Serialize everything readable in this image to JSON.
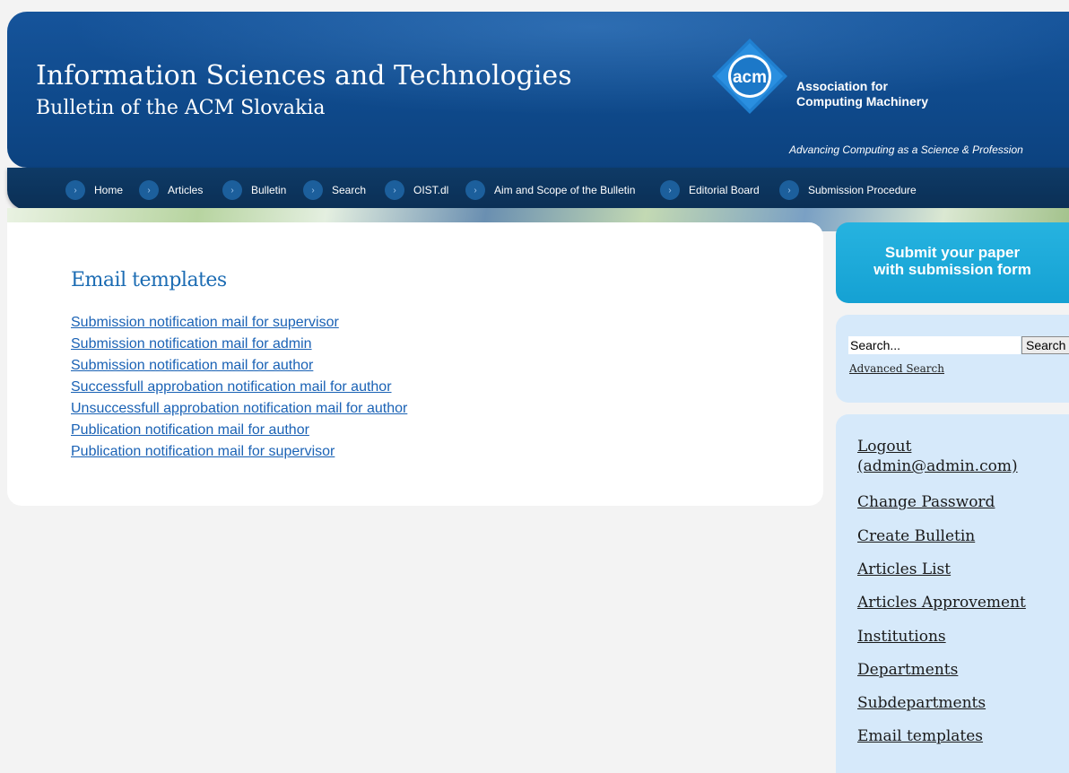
{
  "header": {
    "title": "Information Sciences and Technologies",
    "subtitle": "Bulletin of the ACM Slovakia",
    "acm_logo_text": "acm",
    "acm_org_line1": "Association for",
    "acm_org_line2": "Computing Machinery",
    "acm_tagline": "Advancing Computing as a Science & Profession"
  },
  "nav": {
    "items": [
      {
        "label": "Home"
      },
      {
        "label": "Articles"
      },
      {
        "label": "Bulletin"
      },
      {
        "label": "Search"
      },
      {
        "label": "OIST.dl"
      },
      {
        "label": "Aim and Scope of the Bulletin"
      },
      {
        "label": "Editorial Board"
      },
      {
        "label": "Submission Procedure"
      }
    ],
    "bullet_glyph": "›"
  },
  "main": {
    "title": "Email templates",
    "templates": [
      "Submission notification mail for supervisor",
      "Submission notification mail for admin",
      "Submission notification mail for author",
      "Successfull approbation notification mail for author",
      "Unsuccessfull approbation notification mail for author",
      "Publication notification mail for author",
      "Publication notification mail for supervisor"
    ]
  },
  "sidebar": {
    "submit_line1": "Submit your paper",
    "submit_line2": "with submission form",
    "search_value": "Search...",
    "search_button": "Search",
    "advanced_search": "Advanced Search",
    "menu": {
      "logout_line1": "Logout",
      "logout_line2": "(admin@admin.com)",
      "items": [
        "Change Password",
        "Create Bulletin",
        "Articles List",
        "Articles Approvement",
        "Institutions",
        "Departments",
        "Subdepartments",
        "Email templates"
      ]
    }
  },
  "colors": {
    "header_blue": "#0f4a8c",
    "nav_dark": "#0b2f55",
    "link_blue": "#1a62b5",
    "title_blue": "#1c6cb3",
    "submit_cyan": "#15a1d3",
    "sidebar_light": "#d6e9fa"
  }
}
